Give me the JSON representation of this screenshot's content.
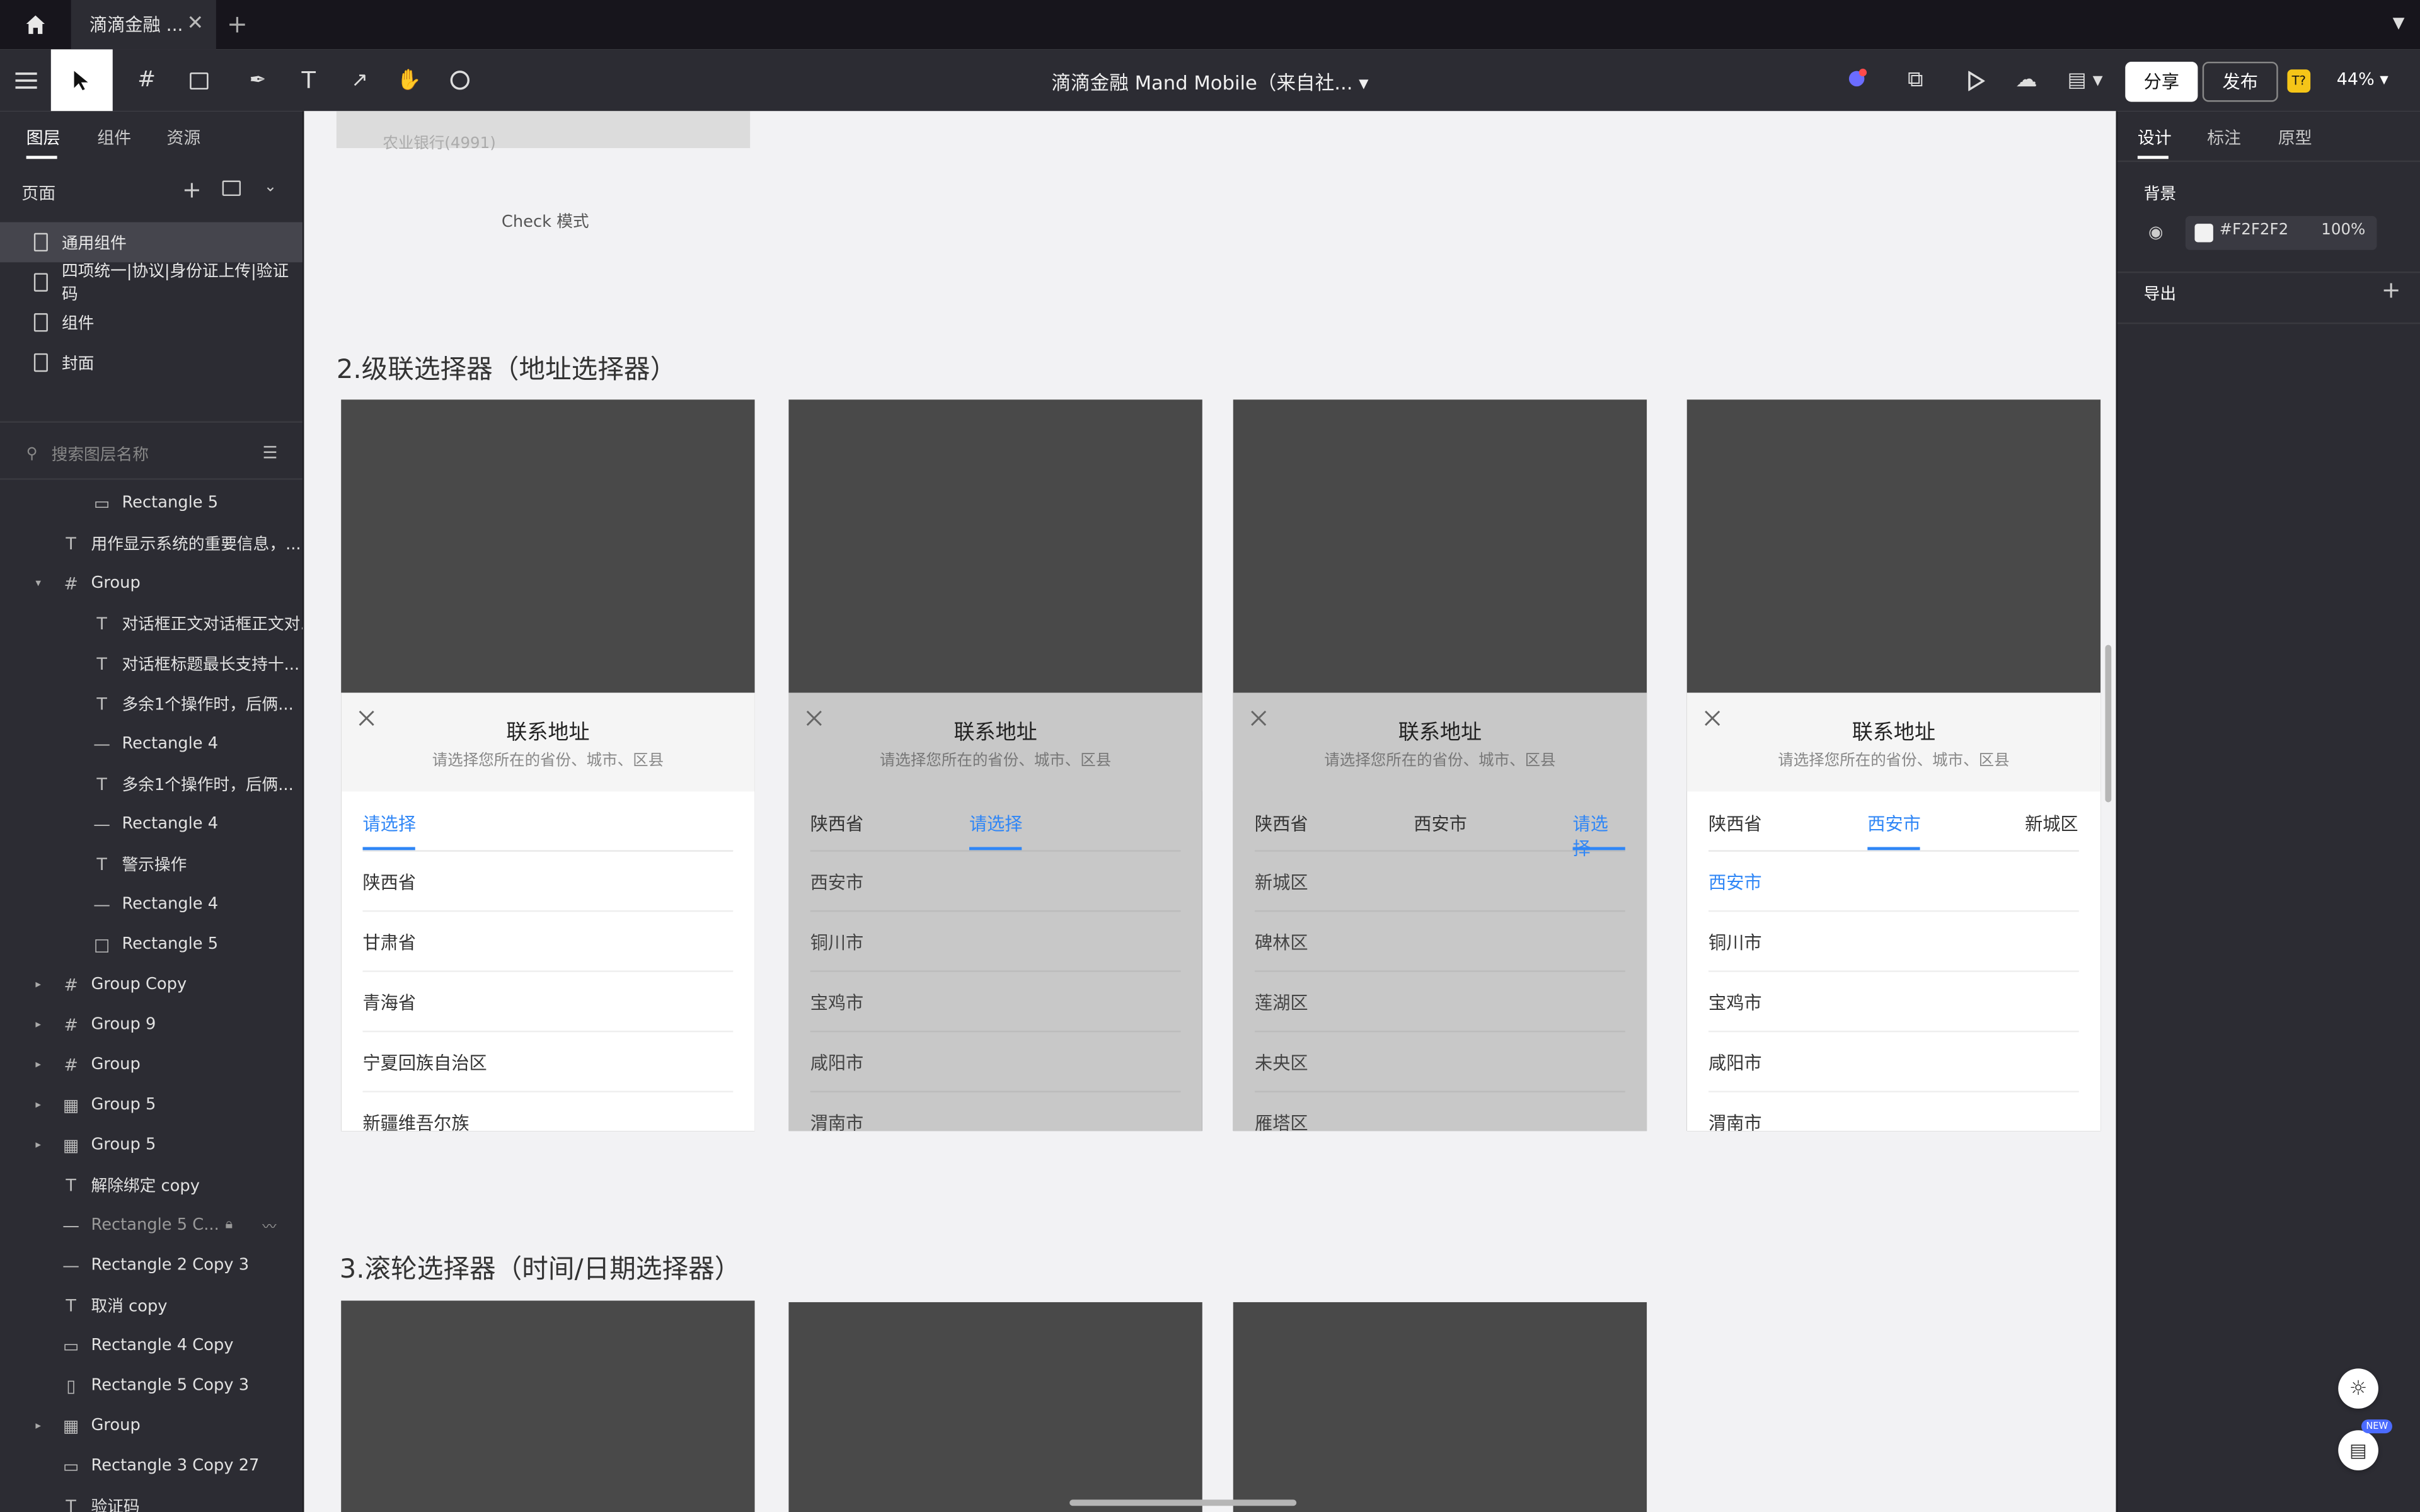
{
  "tabbar": {
    "tab_title": "滴滴金融 ...",
    "close": "✕",
    "new_tab": "+"
  },
  "toolbar": {
    "doc_title": "滴滴金融 Mand Mobile（来自社... ▾",
    "share": "分享",
    "publish": "发布",
    "badge": "T?",
    "zoom": "44% ▾"
  },
  "left": {
    "tabs": [
      "图层",
      "组件",
      "资源"
    ],
    "pages_header": "页面",
    "pages": [
      "通用组件",
      "四项统一|协议|身份证上传|验证码",
      "组件",
      "封面"
    ],
    "search_placeholder": "搜索图层名称",
    "layers": [
      {
        "name": "Rectangle 5",
        "icon": "rect-icon",
        "indent": 2
      },
      {
        "name": "用作显示系统的重要信息，...",
        "icon": "text-icon",
        "indent": 1
      },
      {
        "name": "Group",
        "icon": "frame-icon",
        "indent": 1,
        "arrow": "▾"
      },
      {
        "name": "对话框正文对话框正文对...",
        "icon": "text-icon",
        "indent": 2
      },
      {
        "name": "对话框标题最长支持十...",
        "icon": "text-icon",
        "indent": 2
      },
      {
        "name": "多余1个操作时，后俩...",
        "icon": "text-icon",
        "indent": 2
      },
      {
        "name": "Rectangle 4",
        "icon": "line-icon",
        "indent": 2
      },
      {
        "name": "多余1个操作时，后俩...",
        "icon": "text-icon",
        "indent": 2
      },
      {
        "name": "Rectangle 4",
        "icon": "line-icon",
        "indent": 2
      },
      {
        "name": "警示操作",
        "icon": "text-icon",
        "indent": 2
      },
      {
        "name": "Rectangle 4",
        "icon": "line-icon",
        "indent": 2
      },
      {
        "name": "Rectangle 5",
        "icon": "square-icon",
        "indent": 2
      },
      {
        "name": "Group Copy",
        "icon": "frame-icon",
        "indent": 1,
        "arrow": "▸"
      },
      {
        "name": "Group 9",
        "icon": "frame-icon",
        "indent": 1,
        "arrow": "▸"
      },
      {
        "name": "Group",
        "icon": "frame-icon",
        "indent": 1,
        "arrow": "▸"
      },
      {
        "name": "Group 5",
        "icon": "component-icon",
        "indent": 1,
        "arrow": "▸"
      },
      {
        "name": "Group 5",
        "icon": "component-icon",
        "indent": 1,
        "arrow": "▸"
      },
      {
        "name": "解除绑定 copy",
        "icon": "text-icon",
        "indent": 1
      },
      {
        "name": "Rectangle 5 C...",
        "icon": "line-icon",
        "indent": 1,
        "dim": true
      },
      {
        "name": "Rectangle 2 Copy 3",
        "icon": "line-icon",
        "indent": 1
      },
      {
        "name": "取消 copy",
        "icon": "text-icon",
        "indent": 1
      },
      {
        "name": "Rectangle 4 Copy",
        "icon": "rect-icon",
        "indent": 1
      },
      {
        "name": "Rectangle 5 Copy 3",
        "icon": "vrect-icon",
        "indent": 1
      },
      {
        "name": "Group",
        "icon": "component-icon",
        "indent": 1,
        "arrow": "▸"
      },
      {
        "name": "Rectangle 3 Copy 27",
        "icon": "rect-icon",
        "indent": 1
      },
      {
        "name": "验证码",
        "icon": "text-icon",
        "indent": 1
      }
    ]
  },
  "right": {
    "tabs": [
      "设计",
      "标注",
      "原型"
    ],
    "background_label": "背景",
    "bg_hex": "#F2F2F2",
    "bg_opacity": "100%",
    "export_label": "导出",
    "new_badge": "NEW"
  },
  "canvas": {
    "top_faded": "农业银行(4991)",
    "check_mode": "Check 模式",
    "section2": "2.级联选择器（地址选择器）",
    "section3": "3.滚轮选择器（时间/日期选择器）",
    "sheet_title": "联系地址",
    "sheet_sub": "请选择您所在的省份、城市、区县",
    "pickers": [
      {
        "dim": false,
        "tabs": [
          {
            "t": "请选择",
            "a": true
          }
        ],
        "opts": [
          "陕西省",
          "甘肃省",
          "青海省",
          "宁夏回族自治区",
          "新疆维吾尔族"
        ],
        "active_opt": -1
      },
      {
        "dim": true,
        "tabs": [
          {
            "t": "陕西省",
            "a": false
          },
          {
            "t": "请选择",
            "a": true
          }
        ],
        "opts": [
          "西安市",
          "铜川市",
          "宝鸡市",
          "咸阳市",
          "渭南市"
        ],
        "active_opt": -1
      },
      {
        "dim": true,
        "tabs": [
          {
            "t": "陕西省",
            "a": false
          },
          {
            "t": "西安市",
            "a": false
          },
          {
            "t": "请选择",
            "a": true
          }
        ],
        "opts": [
          "新城区",
          "碑林区",
          "莲湖区",
          "未央区",
          "雁塔区"
        ],
        "active_opt": -1
      },
      {
        "dim": false,
        "tabs": [
          {
            "t": "陕西省",
            "a": false
          },
          {
            "t": "西安市",
            "a": true
          },
          {
            "t": "新城区",
            "a": false
          }
        ],
        "opts": [
          "西安市",
          "铜川市",
          "宝鸡市",
          "咸阳市",
          "渭南市"
        ],
        "active_opt": 0
      }
    ]
  },
  "colors": {
    "accent": "#2f86f6",
    "panel": "#2c2c33",
    "canvas": "#f2f2f4",
    "phone": "#494949"
  }
}
